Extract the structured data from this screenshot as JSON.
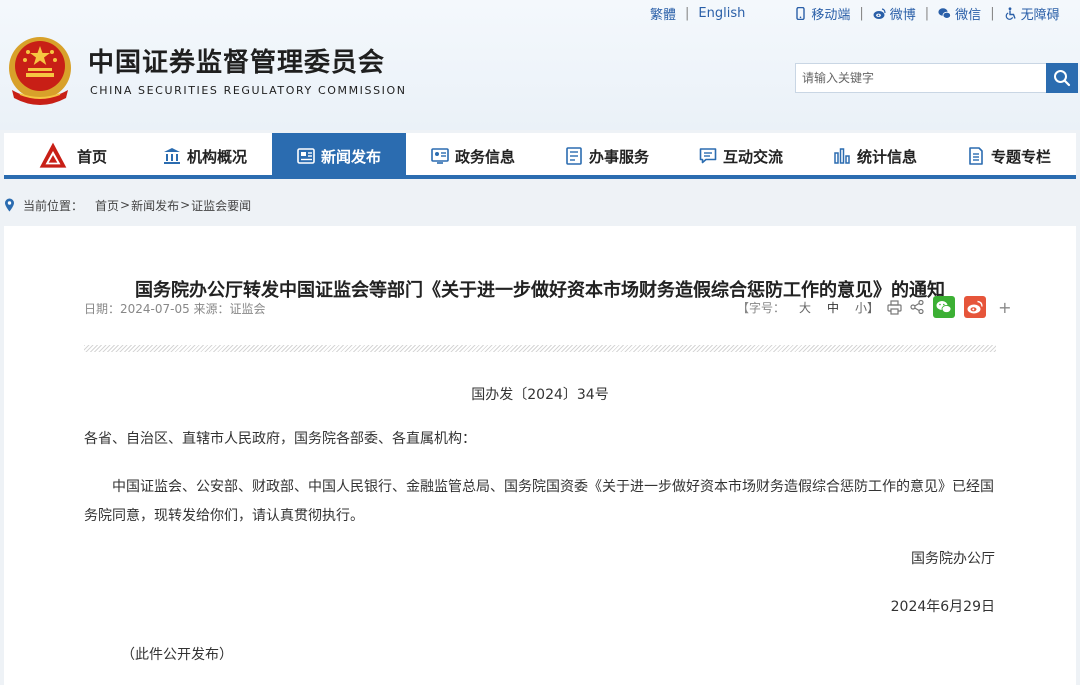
{
  "top_links": {
    "traditional": "繁體",
    "english": "English",
    "mobile": "移动端",
    "weibo": "微博",
    "wechat": "微信",
    "accessibility": "无障碍"
  },
  "site": {
    "name_cn": "中国证券监督管理委员会",
    "name_en": "CHINA SECURITIES REGULATORY COMMISSION"
  },
  "search": {
    "placeholder": "请输入关键字"
  },
  "nav": [
    {
      "label": "首页",
      "icon": "csrc-logo-icon"
    },
    {
      "label": "机构概况",
      "icon": "institution-icon"
    },
    {
      "label": "新闻发布",
      "icon": "news-icon",
      "active": true
    },
    {
      "label": "政务信息",
      "icon": "gov-info-icon"
    },
    {
      "label": "办事服务",
      "icon": "service-icon"
    },
    {
      "label": "互动交流",
      "icon": "chat-icon"
    },
    {
      "label": "统计信息",
      "icon": "stats-icon"
    },
    {
      "label": "专题专栏",
      "icon": "topic-icon"
    }
  ],
  "breadcrumb": {
    "label": "当前位置：",
    "items": [
      "首页",
      "新闻发布",
      "证监会要闻"
    ]
  },
  "article": {
    "title": "国务院办公厅转发中国证监会等部门《关于进一步做好资本市场财务造假综合惩防工作的意见》的通知",
    "meta": "日期：2024-07-05 来源：证监会",
    "font_size_label": "【字号：",
    "font_sizes": [
      "大",
      "中",
      "小】"
    ],
    "doc_number": "国办发〔2024〕34号",
    "salutation": "各省、自治区、直辖市人民政府，国务院各部委、各直属机构：",
    "body": "中国证监会、公安部、财政部、中国人民银行、金融监管总局、国务院国资委《关于进一步做好资本市场财务造假综合惩防工作的意见》已经国务院同意，现转发给你们，请认真贯彻执行。",
    "signature": "国务院办公厅",
    "date": "2024年6月29日",
    "note": "（此件公开发布）"
  },
  "colors": {
    "brand_blue": "#2b6cb0",
    "wechat_green": "#3cb034",
    "weibo_red": "#e6553a"
  }
}
